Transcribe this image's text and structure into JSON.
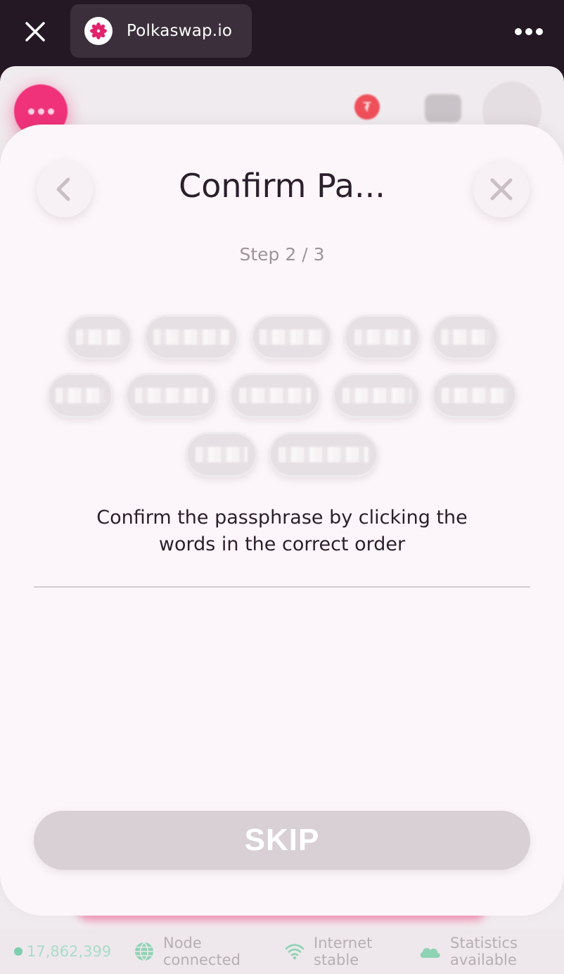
{
  "browser": {
    "tab_title": "Polkaswap.io",
    "close_icon": "close-icon",
    "more_icon": "more-horizontal-icon"
  },
  "status_bar": {
    "block_number": "17,862,399",
    "node_line1": "Node",
    "node_line2": "connected",
    "internet_line1": "Internet",
    "internet_line2": "stable",
    "stats_line1": "Statistics",
    "stats_line2": "available"
  },
  "dialog": {
    "title": "Confirm Pa...",
    "step": "Step 2 / 3",
    "word_pill_count": 12,
    "instruction": "Confirm the passphrase by clicking the words in the correct order",
    "skip_label": "SKIP"
  },
  "colors": {
    "accent": "#f0327a",
    "status_green": "#7ecfae",
    "dialog_bg": "#fcf6fa"
  }
}
